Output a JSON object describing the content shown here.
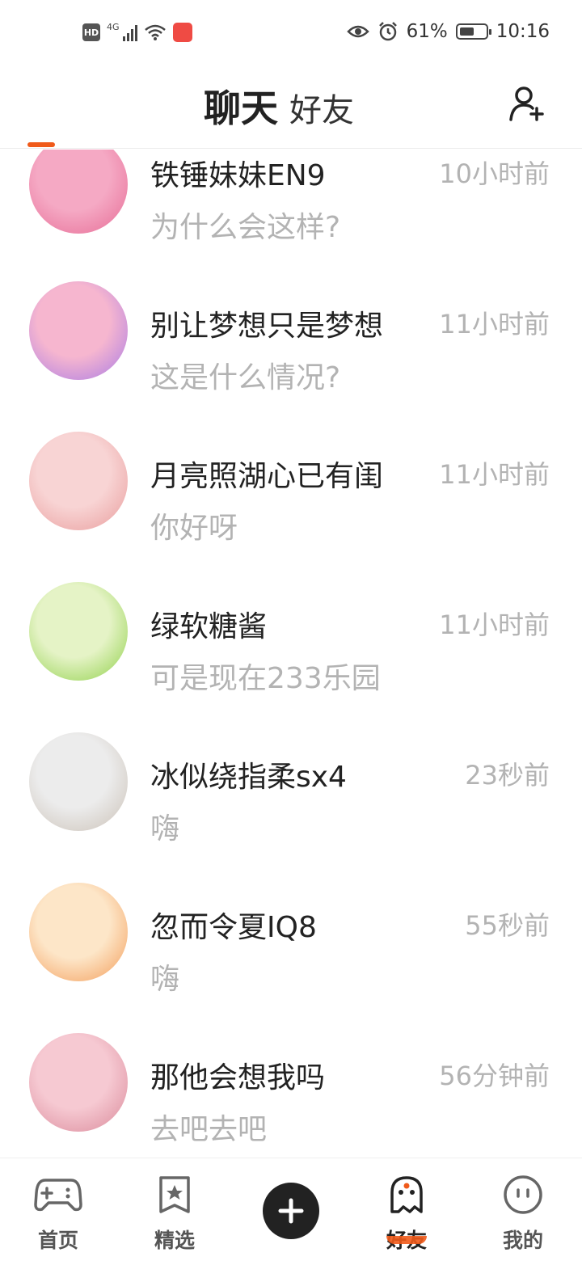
{
  "status_bar": {
    "hd": "HD",
    "network": "4G",
    "battery_percent": "61%",
    "battery_level": 0.61,
    "time": "10:16"
  },
  "header": {
    "tabs": [
      {
        "label": "聊天",
        "active": true
      },
      {
        "label": "好友",
        "active": false
      }
    ],
    "add_friend_icon": "add-user-icon"
  },
  "chats": [
    {
      "name": "铁锤妹妹EN9",
      "time": "10小时前",
      "message": "为什么会这样?",
      "avatar_colors": [
        "#f5a9c4",
        "#e66a94"
      ]
    },
    {
      "name": "别让梦想只是梦想",
      "time": "11小时前",
      "message": "这是什么情况?",
      "avatar_colors": [
        "#f6b6cf",
        "#a678e6"
      ]
    },
    {
      "name": "月亮照湖心已有闺",
      "time": "11小时前",
      "message": "你好呀",
      "avatar_colors": [
        "#f8d4d4",
        "#e89a9a"
      ]
    },
    {
      "name": "绿软糖酱",
      "time": "11小时前",
      "message": "可是现在233乐园",
      "avatar_colors": [
        "#e5f3c6",
        "#8ccf44"
      ]
    },
    {
      "name": "冰似绕指柔sx4",
      "time": "23秒前",
      "message": "嗨",
      "avatar_colors": [
        "#ececec",
        "#c9bfb4"
      ]
    },
    {
      "name": "忽而令夏IQ8",
      "time": "55秒前",
      "message": "嗨",
      "avatar_colors": [
        "#fde6c8",
        "#f39a55"
      ]
    },
    {
      "name": "那他会想我吗",
      "time": "56分钟前",
      "message": "去吧去吧",
      "avatar_colors": [
        "#f6c9d2",
        "#d98798"
      ]
    }
  ],
  "bottom_nav": {
    "items": [
      {
        "label": "首页",
        "icon": "gamepad-icon"
      },
      {
        "label": "精选",
        "icon": "star-bookmark-icon"
      },
      {
        "label": "好友",
        "icon": "ghost-icon",
        "active": true
      },
      {
        "label": "我的",
        "icon": "face-icon"
      }
    ],
    "plus_icon": "plus-icon"
  },
  "colors": {
    "accent": "#f05a1a",
    "text_primary": "#222222",
    "text_secondary": "#b3b3b3"
  }
}
